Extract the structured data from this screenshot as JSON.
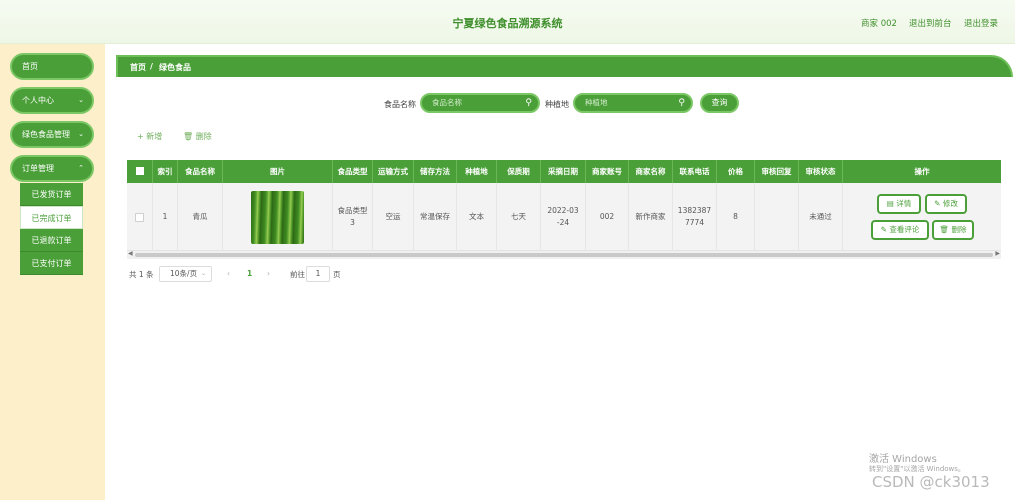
{
  "header": {
    "title": "宁夏绿色食品溯源系统",
    "user": "商家 002",
    "front_link": "退出到前台",
    "logout_link": "退出登录"
  },
  "sidebar": {
    "items": [
      {
        "label": "首页"
      },
      {
        "label": "个人中心"
      },
      {
        "label": "绿色食品管理"
      },
      {
        "label": "订单管理"
      }
    ],
    "order_submenu": [
      {
        "label": "已发货订单"
      },
      {
        "label": "已完成订单"
      },
      {
        "label": "已退款订单"
      },
      {
        "label": "已支付订单"
      }
    ]
  },
  "breadcrumb": {
    "home": "首页",
    "sep": "/",
    "current": "绿色食品"
  },
  "search": {
    "name_label": "食品名称",
    "name_placeholder": "食品名称",
    "origin_label": "种植地",
    "origin_placeholder": "种植地",
    "query_button": "查询"
  },
  "toolbar": {
    "add": "新增",
    "delete": "删除"
  },
  "table": {
    "columns": [
      "索引",
      "食品名称",
      "图片",
      "食品类型",
      "运输方式",
      "储存方法",
      "种植地",
      "保质期",
      "采摘日期",
      "商家账号",
      "商家名称",
      "联系电话",
      "价格",
      "审核回复",
      "审核状态",
      "操作"
    ],
    "rows": [
      {
        "index": "1",
        "name": "青瓜",
        "image": "cucumbers",
        "type": "食品类型\n3",
        "transport": "空运",
        "storage": "常温保存",
        "origin": "文本",
        "shelf_life": "七天",
        "pick_date": "2022-03\n-24",
        "merchant_account": "002",
        "merchant_name": "新作商家",
        "phone": "1382387\n7774",
        "price": "8",
        "review_reply": "",
        "review_status": "未通过",
        "actions": {
          "detail": "详情",
          "edit": "修改",
          "comments": "查看评论",
          "delete": "删除"
        }
      }
    ]
  },
  "pagination": {
    "total": "共 1 条",
    "page_size": "10条/页",
    "prev": "‹",
    "current_page": "1",
    "next": "›",
    "goto_label": "前往",
    "goto_value": "1",
    "page_suffix": "页"
  },
  "watermark": {
    "windows_title": "激活 Windows",
    "windows_sub": "转到\"设置\"以激活 Windows。",
    "csdn": "CSDN @ck3013"
  },
  "colors": {
    "primary": "#4a9f38",
    "sidebar_bg": "#fdefc9",
    "header_title": "#3f8f2c"
  }
}
